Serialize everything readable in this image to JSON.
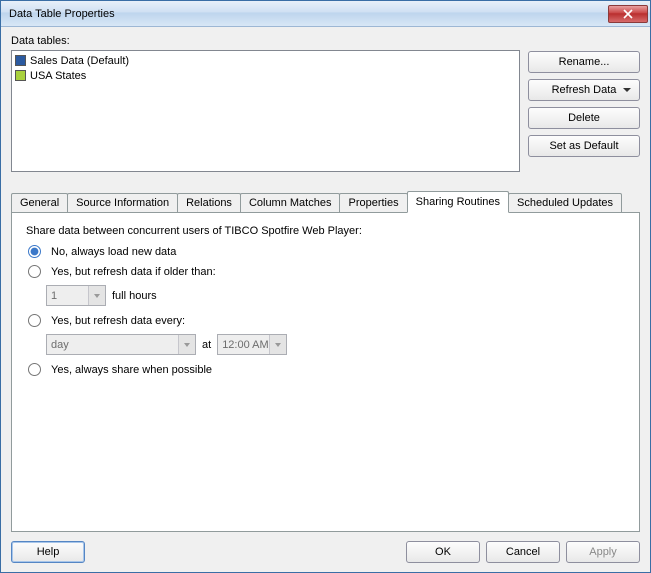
{
  "window": {
    "title": "Data Table Properties"
  },
  "data_tables": {
    "label": "Data tables:",
    "items": [
      {
        "name": "Sales Data (Default)",
        "color": "blue"
      },
      {
        "name": "USA States",
        "color": "green"
      }
    ]
  },
  "side_buttons": {
    "rename": "Rename...",
    "refresh": "Refresh Data",
    "delete": "Delete",
    "set_default": "Set as Default"
  },
  "tabs": {
    "general": "General",
    "source_info": "Source Information",
    "relations": "Relations",
    "column_matches": "Column Matches",
    "properties": "Properties",
    "sharing_routines": "Sharing Routines",
    "scheduled_updates": "Scheduled Updates"
  },
  "panel": {
    "intro": "Share data between concurrent users of TIBCO Spotfire Web Player:",
    "opt_no": "No, always load new data",
    "opt_older": "Yes, but refresh data if older than:",
    "hours_value": "1",
    "hours_unit": "full hours",
    "opt_every": "Yes, but refresh data every:",
    "every_unit": "day",
    "every_at": "at",
    "every_time": "12:00 AM",
    "opt_always": "Yes, always share when possible"
  },
  "footer": {
    "help": "Help",
    "ok": "OK",
    "cancel": "Cancel",
    "apply": "Apply"
  }
}
